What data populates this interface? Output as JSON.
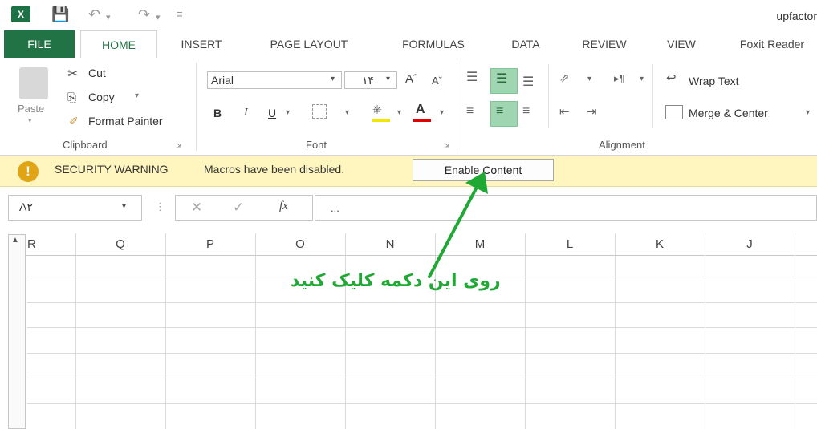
{
  "title_bar": {
    "logo_text": "X",
    "doc_title": "upfactor"
  },
  "tabs": [
    "FILE",
    "HOME",
    "INSERT",
    "PAGE LAYOUT",
    "FORMULAS",
    "DATA",
    "REVIEW",
    "VIEW",
    "Foxit Reader"
  ],
  "ribbon": {
    "clipboard": {
      "paste": "Paste",
      "cut": "Cut",
      "copy": "Copy",
      "format_painter": "Format Painter",
      "label": "Clipboard"
    },
    "font": {
      "font_name": "Arial",
      "font_size": "۱۴",
      "bold": "B",
      "italic": "I",
      "underline": "U",
      "label": "Font"
    },
    "alignment": {
      "wrap_text": "Wrap Text",
      "merge_center": "Merge & Center",
      "label": "Alignment"
    }
  },
  "security_bar": {
    "icon": "!",
    "title": "SECURITY WARNING",
    "message": "Macros have been disabled.",
    "button": "Enable Content"
  },
  "formula_bar": {
    "name_box": "A۲",
    "fx": "fx",
    "formula_value": "..."
  },
  "columns": [
    "R",
    "Q",
    "P",
    "O",
    "N",
    "M",
    "L",
    "K",
    "J"
  ],
  "annotation": {
    "text": "روی این دکمه کلیک کنید",
    "color": "#1fa833"
  }
}
